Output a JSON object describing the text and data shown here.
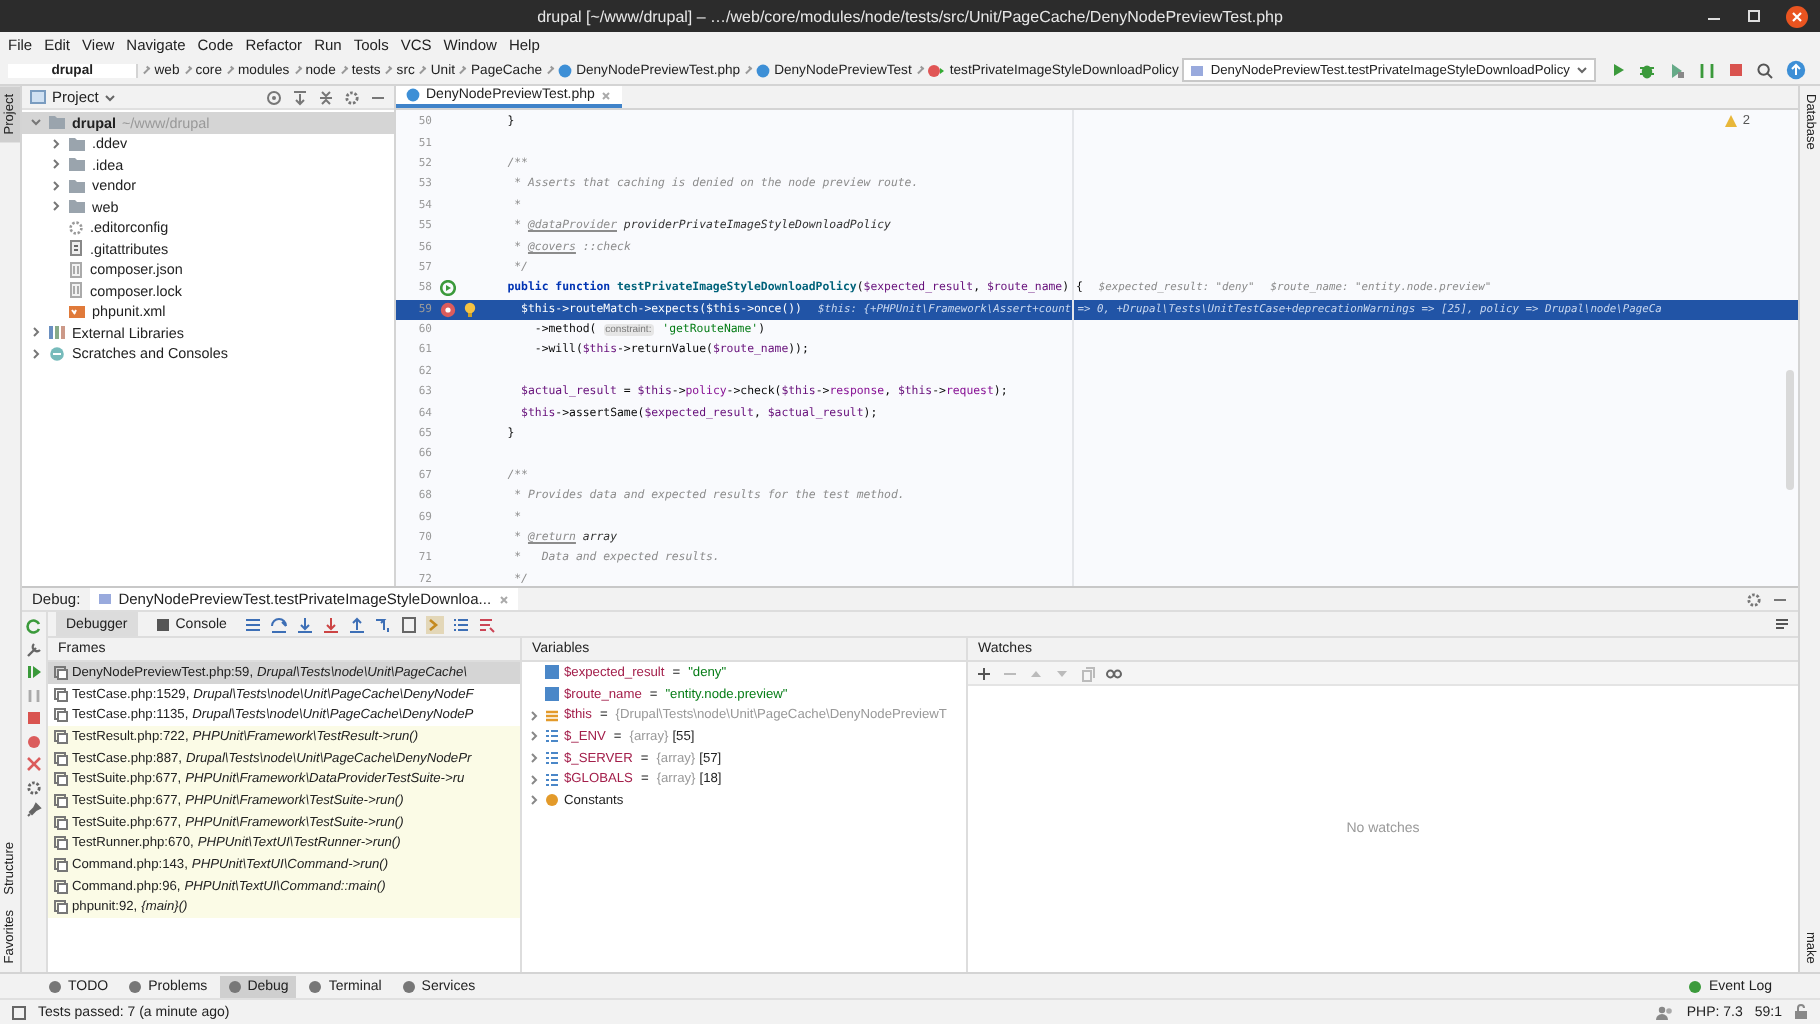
{
  "window": {
    "title": "drupal [~/www/drupal] – …/web/core/modules/node/tests/src/Unit/PageCache/DenyNodePreviewTest.php"
  },
  "menu": [
    "File",
    "Edit",
    "View",
    "Navigate",
    "Code",
    "Refactor",
    "Run",
    "Tools",
    "VCS",
    "Window",
    "Help"
  ],
  "breadcrumb": [
    {
      "label": "drupal",
      "kind": "project"
    },
    {
      "label": "web",
      "kind": "dir"
    },
    {
      "label": "core",
      "kind": "dir"
    },
    {
      "label": "modules",
      "kind": "dir"
    },
    {
      "label": "node",
      "kind": "dir"
    },
    {
      "label": "tests",
      "kind": "dir"
    },
    {
      "label": "src",
      "kind": "dir"
    },
    {
      "label": "Unit",
      "kind": "dir"
    },
    {
      "label": "PageCache",
      "kind": "dir"
    },
    {
      "label": "DenyNodePreviewTest.php",
      "kind": "file"
    },
    {
      "label": "DenyNodePreviewTest",
      "kind": "class"
    },
    {
      "label": "testPrivateImageStyleDownloadPolicy",
      "kind": "method"
    }
  ],
  "run_config": "DenyNodePreviewTest.testPrivateImageStyleDownloadPolicy",
  "left_strip": {
    "top": [
      {
        "label": "Project",
        "selected": true
      }
    ],
    "bottom": [
      {
        "label": "Structure",
        "selected": false
      },
      {
        "label": "Favorites",
        "selected": false
      }
    ]
  },
  "right_strip": {
    "top": [
      {
        "label": "Database",
        "selected": false
      }
    ],
    "bottom": [
      {
        "label": "make",
        "selected": false
      }
    ]
  },
  "project": {
    "title": "Project",
    "tree": [
      {
        "label": "drupal",
        "path": "~/www/drupal",
        "kind": "folder",
        "expanded": true,
        "selected": true,
        "children": [
          {
            "label": ".ddev",
            "kind": "folder",
            "expanded": false,
            "selected": false
          },
          {
            "label": ".idea",
            "kind": "folder",
            "expanded": false,
            "selected": false
          },
          {
            "label": "vendor",
            "kind": "folder",
            "expanded": false,
            "selected": false
          },
          {
            "label": "web",
            "kind": "folder",
            "expanded": false,
            "selected": false
          },
          {
            "label": ".editorconfig",
            "kind": "config",
            "selected": false
          },
          {
            "label": ".gitattributes",
            "kind": "text",
            "selected": false
          },
          {
            "label": "composer.json",
            "kind": "json",
            "selected": false
          },
          {
            "label": "composer.lock",
            "kind": "json",
            "selected": false
          },
          {
            "label": "phpunit.xml",
            "kind": "xml",
            "selected": false
          }
        ]
      },
      {
        "label": "External Libraries",
        "kind": "library",
        "expanded": false,
        "selected": false
      },
      {
        "label": "Scratches and Consoles",
        "kind": "scratches",
        "expanded": false,
        "selected": false
      }
    ]
  },
  "editor": {
    "tab": {
      "label": "DenyNodePreviewTest.php",
      "selected": true
    },
    "warnings": "2",
    "lines": [
      {
        "number": "50",
        "current": false,
        "segments": [
          {
            "kind": "plain",
            "text": "    }"
          }
        ]
      },
      {
        "number": "51",
        "current": false
      },
      {
        "number": "52",
        "current": false,
        "segments": [
          {
            "kind": "doc",
            "text": "    /**"
          }
        ]
      },
      {
        "number": "53",
        "current": false,
        "segments": [
          {
            "kind": "doc",
            "text": "     * Asserts that caching is denied on the node preview route."
          }
        ]
      },
      {
        "number": "54",
        "current": false,
        "segments": [
          {
            "kind": "doc",
            "text": "     *"
          }
        ]
      },
      {
        "number": "55",
        "current": false,
        "segments": [
          {
            "kind": "doc",
            "text": "     * "
          },
          {
            "kind": "tag",
            "text": "@dataProvider"
          },
          {
            "kind": "docref",
            "text": " providerPrivateImageStyleDownloadPolicy"
          }
        ]
      },
      {
        "number": "56",
        "current": false,
        "segments": [
          {
            "kind": "doc",
            "text": "     * "
          },
          {
            "kind": "tag",
            "text": "@covers"
          },
          {
            "kind": "doc",
            "text": " ::check"
          }
        ]
      },
      {
        "number": "57",
        "current": false,
        "segments": [
          {
            "kind": "doc",
            "text": "     */"
          }
        ]
      },
      {
        "number": "58",
        "current": false,
        "runnable": true,
        "segments": [
          {
            "kind": "kw",
            "text": "    public function "
          },
          {
            "kind": "fn",
            "text": "testPrivateImageStyleDownloadPolicy"
          },
          {
            "kind": "plain",
            "text": "("
          },
          {
            "kind": "var",
            "text": "$expected_result"
          },
          {
            "kind": "plain",
            "text": ", "
          },
          {
            "kind": "var",
            "text": "$route_name"
          },
          {
            "kind": "plain",
            "text": ") {"
          }
        ],
        "hints": [
          "$expected_result: \"deny\"",
          "$route_name: \"entity.node.preview\""
        ]
      },
      {
        "number": "59",
        "current": true,
        "breakpoint": true,
        "segments": [
          {
            "kind": "var",
            "text": "      $this"
          },
          {
            "kind": "plain",
            "text": "->"
          },
          {
            "kind": "field",
            "text": "routeMatch"
          },
          {
            "kind": "plain",
            "text": "->expects("
          },
          {
            "kind": "var",
            "text": "$this"
          },
          {
            "kind": "plain",
            "text": "->once())"
          }
        ],
        "hints": [
          "$this: {+PHPUnit\\Framework\\Assert+count => 0, +Drupal\\Tests\\UnitTestCase+deprecationWarnings => [25], policy => Drupal\\node\\PageCa"
        ]
      },
      {
        "number": "60",
        "current": false,
        "segments": [
          {
            "kind": "plain",
            "text": "        ->method( "
          },
          {
            "kind": "param",
            "text": "constraint:"
          },
          {
            "kind": "str",
            "text": " 'getRouteName'"
          },
          {
            "kind": "plain",
            "text": ")"
          }
        ]
      },
      {
        "number": "61",
        "current": false,
        "segments": [
          {
            "kind": "plain",
            "text": "        ->will("
          },
          {
            "kind": "var",
            "text": "$this"
          },
          {
            "kind": "plain",
            "text": "->returnValue("
          },
          {
            "kind": "var",
            "text": "$route_name"
          },
          {
            "kind": "plain",
            "text": "));"
          }
        ]
      },
      {
        "number": "62",
        "current": false
      },
      {
        "number": "63",
        "current": false,
        "segments": [
          {
            "kind": "var",
            "text": "      $actual_result"
          },
          {
            "kind": "plain",
            "text": " = "
          },
          {
            "kind": "var",
            "text": "$this"
          },
          {
            "kind": "plain",
            "text": "->"
          },
          {
            "kind": "field",
            "text": "policy"
          },
          {
            "kind": "plain",
            "text": "->check("
          },
          {
            "kind": "var",
            "text": "$this"
          },
          {
            "kind": "plain",
            "text": "->"
          },
          {
            "kind": "field",
            "text": "response"
          },
          {
            "kind": "plain",
            "text": ", "
          },
          {
            "kind": "var",
            "text": "$this"
          },
          {
            "kind": "plain",
            "text": "->"
          },
          {
            "kind": "field",
            "text": "request"
          },
          {
            "kind": "plain",
            "text": ");"
          }
        ]
      },
      {
        "number": "64",
        "current": false,
        "segments": [
          {
            "kind": "var",
            "text": "      $this"
          },
          {
            "kind": "plain",
            "text": "->assertSame("
          },
          {
            "kind": "var",
            "text": "$expected_result"
          },
          {
            "kind": "plain",
            "text": ", "
          },
          {
            "kind": "var",
            "text": "$actual_result"
          },
          {
            "kind": "plain",
            "text": ");"
          }
        ]
      },
      {
        "number": "65",
        "current": false,
        "segments": [
          {
            "kind": "plain",
            "text": "    }"
          }
        ]
      },
      {
        "number": "66",
        "current": false
      },
      {
        "number": "67",
        "current": false,
        "segments": [
          {
            "kind": "doc",
            "text": "    /**"
          }
        ]
      },
      {
        "number": "68",
        "current": false,
        "segments": [
          {
            "kind": "doc",
            "text": "     * Provides data and expected results for the test method."
          }
        ]
      },
      {
        "number": "69",
        "current": false,
        "segments": [
          {
            "kind": "doc",
            "text": "     *"
          }
        ]
      },
      {
        "number": "70",
        "current": false,
        "segments": [
          {
            "kind": "doc",
            "text": "     * "
          },
          {
            "kind": "tag",
            "text": "@return"
          },
          {
            "kind": "docref",
            "text": " array"
          }
        ]
      },
      {
        "number": "71",
        "current": false,
        "segments": [
          {
            "kind": "doc",
            "text": "     *   Data and expected results."
          }
        ]
      },
      {
        "number": "72",
        "current": false,
        "segments": [
          {
            "kind": "doc",
            "text": "     */"
          }
        ]
      }
    ]
  },
  "debug": {
    "label": "Debug:",
    "session": "DenyNodePreviewTest.testPrivateImageStyleDownloa...",
    "tabs": [
      {
        "label": "Debugger",
        "selected": true
      },
      {
        "label": "Console",
        "selected": false
      }
    ],
    "frames_title": "Frames",
    "frames": [
      {
        "file": "DenyNodePreviewTest.php:59, ",
        "method": "Drupal\\Tests\\node\\Unit\\PageCache\\",
        "library": false,
        "selected": true
      },
      {
        "file": "TestCase.php:1529, ",
        "method": "Drupal\\Tests\\node\\Unit\\PageCache\\DenyNodeF",
        "library": false,
        "selected": false
      },
      {
        "file": "TestCase.php:1135, ",
        "method": "Drupal\\Tests\\node\\Unit\\PageCache\\DenyNodeP",
        "library": false,
        "selected": false
      },
      {
        "file": "TestResult.php:722, ",
        "method": "PHPUnit\\Framework\\TestResult->run()",
        "library": true,
        "selected": false
      },
      {
        "file": "TestCase.php:887, ",
        "method": "Drupal\\Tests\\node\\Unit\\PageCache\\DenyNodePr",
        "library": true,
        "selected": false
      },
      {
        "file": "TestSuite.php:677, ",
        "method": "PHPUnit\\Framework\\DataProviderTestSuite->ru",
        "library": true,
        "selected": false
      },
      {
        "file": "TestSuite.php:677, ",
        "method": "PHPUnit\\Framework\\TestSuite->run()",
        "library": true,
        "selected": false
      },
      {
        "file": "TestSuite.php:677, ",
        "method": "PHPUnit\\Framework\\TestSuite->run()",
        "library": true,
        "selected": false
      },
      {
        "file": "TestRunner.php:670, ",
        "method": "PHPUnit\\TextUI\\TestRunner->run()",
        "library": true,
        "selected": false
      },
      {
        "file": "Command.php:143, ",
        "method": "PHPUnit\\TextUI\\Command->run()",
        "library": true,
        "selected": false
      },
      {
        "file": "Command.php:96, ",
        "method": "PHPUnit\\TextUI\\Command::main()",
        "library": true,
        "selected": false
      },
      {
        "file": "phpunit:92, ",
        "method": "{main}()",
        "library": true,
        "selected": false
      }
    ],
    "variables_title": "Variables",
    "variables": [
      {
        "kind": "scalar",
        "name": "$expected_result",
        "eq": "=",
        "value": "\"deny\""
      },
      {
        "kind": "scalar",
        "name": "$route_name",
        "eq": "=",
        "value": "\"entity.node.preview\""
      },
      {
        "kind": "object",
        "name": "$this",
        "eq": "=",
        "type": "{Drupal\\Tests\\node\\Unit\\PageCache\\DenyNodePreviewT"
      },
      {
        "kind": "array",
        "name": "$_ENV",
        "eq": "=",
        "type": "{array}",
        "count": "[55]"
      },
      {
        "kind": "array",
        "name": "$_SERVER",
        "eq": "=",
        "type": "{array}",
        "count": "[57]"
      },
      {
        "kind": "array",
        "name": "$GLOBALS",
        "eq": "=",
        "type": "{array}",
        "count": "[18]"
      },
      {
        "kind": "group",
        "name": "Constants"
      }
    ],
    "watches_title": "Watches",
    "watches_empty": "No watches"
  },
  "tool_tabs": [
    {
      "label": "TODO",
      "selected": false
    },
    {
      "label": "Problems",
      "selected": false
    },
    {
      "label": "Debug",
      "selected": true
    },
    {
      "label": "Terminal",
      "selected": false
    },
    {
      "label": "Services",
      "selected": false
    }
  ],
  "event_log": "Event Log",
  "status_bar": {
    "message": "Tests passed: 7 (a minute ago)",
    "php": "PHP: 7.3",
    "position": "59:1"
  }
}
